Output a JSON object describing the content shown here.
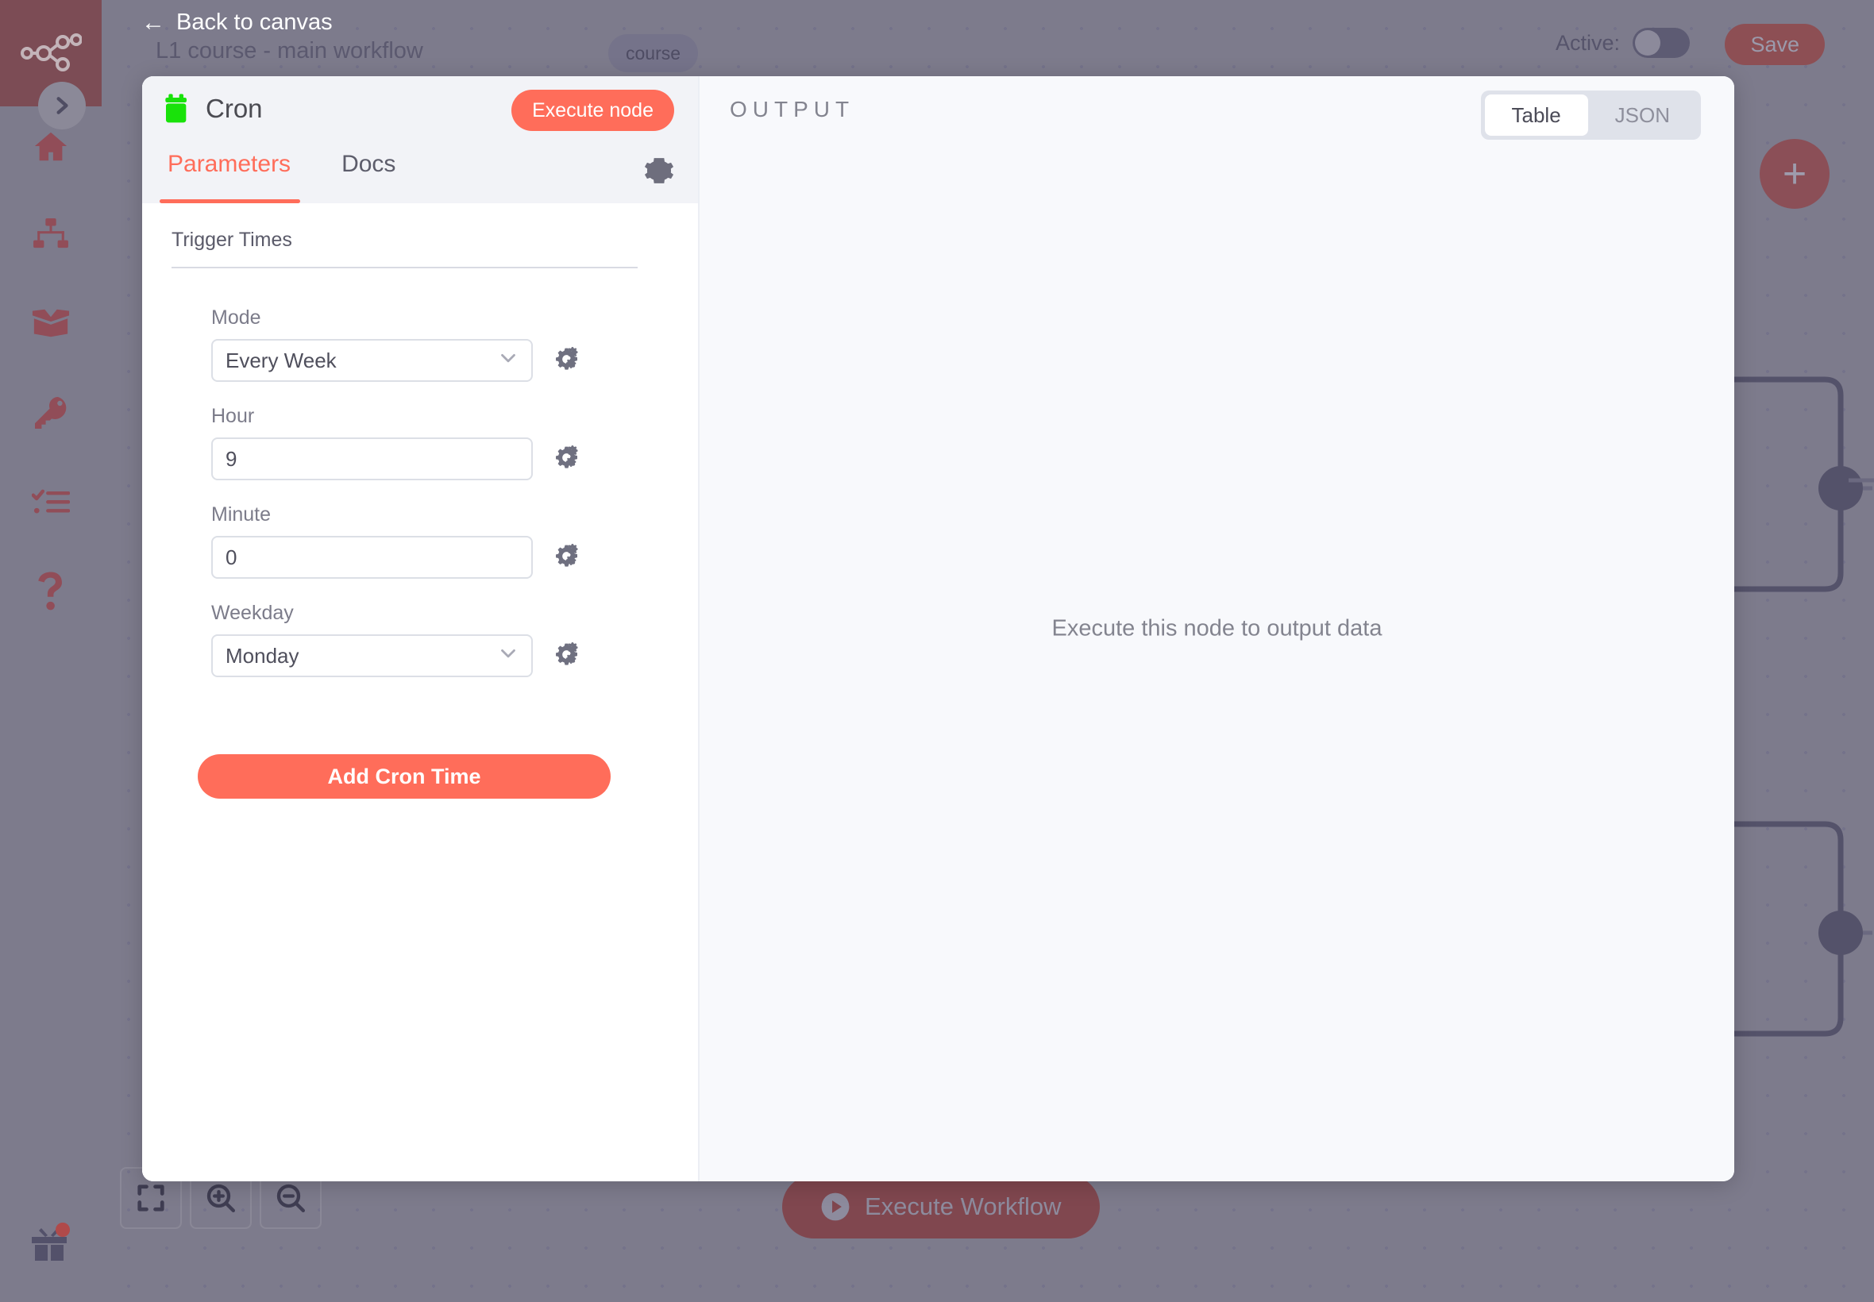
{
  "header": {
    "back_label": "Back to canvas",
    "back_icon": "arrow-left-icon",
    "workflow_name": "L1 course - main workflow",
    "workflow_tag": "course",
    "active_label": "Active:",
    "active_state": "off",
    "save_label": "Save"
  },
  "sidebar": {
    "logo_icon": "n8n-logo-icon",
    "expand_icon": "chevron-right-icon",
    "items": [
      {
        "icon": "home-icon",
        "label": "Home"
      },
      {
        "icon": "sitemap-icon",
        "label": "Workflows"
      },
      {
        "icon": "box-open-icon",
        "label": "Templates"
      },
      {
        "icon": "key-icon",
        "label": "Credentials"
      },
      {
        "icon": "checklist-icon",
        "label": "Executions"
      },
      {
        "icon": "question-mark-icon",
        "label": "Help"
      }
    ],
    "gift_icon": "gift-icon",
    "gift_badge": ""
  },
  "canvas": {
    "add_node_icon": "plus-icon",
    "execute_workflow_label": "Execute Workflow",
    "execute_workflow_icon": "play-circle-icon",
    "zoom_fit_icon": "fit-to-screen-icon",
    "zoom_in_icon": "zoom-in-icon",
    "zoom_out_icon": "zoom-out-icon"
  },
  "ndv": {
    "node_icon": "cron-calendar-icon",
    "node_icon_color": "#19e20a",
    "node_title": "Cron",
    "execute_node_label": "Execute node",
    "settings_icon": "gear-icon",
    "tabs": [
      {
        "label": "Parameters",
        "active": true
      },
      {
        "label": "Docs",
        "active": false
      }
    ],
    "parameters": {
      "section_title": "Trigger Times",
      "fields": [
        {
          "label": "Mode",
          "value": "Every Week",
          "type": "select",
          "options_icon": "chevron-down-icon",
          "settings_icon": "cogs-icon"
        },
        {
          "label": "Hour",
          "value": "9",
          "type": "text",
          "settings_icon": "cogs-icon"
        },
        {
          "label": "Minute",
          "value": "0",
          "type": "text",
          "settings_icon": "cogs-icon"
        },
        {
          "label": "Weekday",
          "value": "Monday",
          "type": "select",
          "options_icon": "chevron-down-icon",
          "settings_icon": "cogs-icon"
        }
      ],
      "add_button_label": "Add Cron Time"
    },
    "output": {
      "title": "OUTPUT",
      "display_modes": [
        {
          "label": "Table",
          "active": true
        },
        {
          "label": "JSON",
          "active": false
        }
      ],
      "empty_message": "Execute this node to output data"
    }
  },
  "colors": {
    "accent": "#ff6d5a",
    "node_icon_green": "#19e20a",
    "canvas_bg": "#7d7b8c",
    "sidebar_logo_bg": "#7c4c55"
  }
}
